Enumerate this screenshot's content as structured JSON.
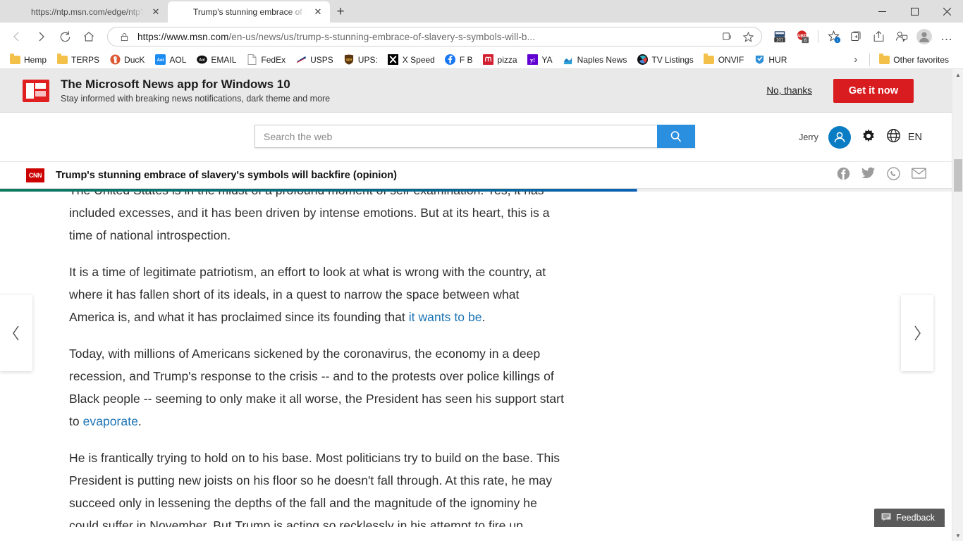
{
  "window": {
    "minimize": "–",
    "maximize": "□",
    "close": "✕"
  },
  "tabs": [
    {
      "title": "https://ntp.msn.com/edge/ntp?locale",
      "favicon": "none",
      "active": false,
      "close_label": "✕"
    },
    {
      "title": "Trump's stunning embrace of sla",
      "favicon": "msn-icon",
      "active": true,
      "close_label": "✕"
    }
  ],
  "new_tab_label": "+",
  "nav": {
    "back": "back-arrow-icon",
    "forward": "forward-arrow-icon",
    "refresh": "refresh-icon",
    "home": "home-icon"
  },
  "omnibox": {
    "lock": "lock-icon",
    "url_prefix": "https://www.",
    "url_domain": "msn.com",
    "url_rest": "/en-us/news/us/trump-s-stunning-embrace-of-slavery-s-symbols-will-b...",
    "url_full": "https://www.msn.com/en-us/news/us/trump-s-stunning-embrace-of-slavery-s-symbols-will-b...",
    "read_aloud": "read-aloud-icon",
    "favorite": "star-icon"
  },
  "toolbar": {
    "collections_badge": "101",
    "adblock_badge": "6",
    "adblock_label": "ABP",
    "favorites": "favorites-star-icon",
    "collections": "collections-icon",
    "share": "share-icon",
    "profile_mini": "profile-add-icon",
    "account": "account-avatar-icon",
    "settings_more": "…"
  },
  "bookmarks": [
    {
      "label": "Hemp",
      "icon": "folder-icon"
    },
    {
      "label": "TERPS",
      "icon": "folder-icon"
    },
    {
      "label": "DucK",
      "icon": "duckduckgo-icon"
    },
    {
      "label": "AOL",
      "icon": "aol-icon"
    },
    {
      "label": "EMAIL",
      "icon": "aol-mail-icon"
    },
    {
      "label": "FedEx",
      "icon": "page-icon"
    },
    {
      "label": "USPS",
      "icon": "usps-icon"
    },
    {
      "label": "UPS:",
      "icon": "ups-icon"
    },
    {
      "label": "X Speed",
      "icon": "x-speed-icon"
    },
    {
      "label": "F B",
      "icon": "facebook-icon"
    },
    {
      "label": "pizza",
      "icon": "pizza-icon"
    },
    {
      "label": "YA",
      "icon": "yahoo-icon"
    },
    {
      "label": "Naples News",
      "icon": "naples-news-icon"
    },
    {
      "label": "TV Listings",
      "icon": "tv-listings-icon"
    },
    {
      "label": "ONVIF",
      "icon": "folder-icon"
    },
    {
      "label": "HUR",
      "icon": "hur-icon"
    }
  ],
  "bookmarks_overflow": "›",
  "other_favorites": {
    "label": "Other favorites",
    "icon": "folder-icon"
  },
  "promo": {
    "logo": "msn-news-app-icon",
    "title": "The Microsoft News app for Windows 10",
    "subtitle": "Stay informed with breaking news notifications, dark theme and more",
    "decline_label": "No, thanks",
    "accept_label": "Get it now",
    "accept_color": "#d81c20"
  },
  "msn_header": {
    "search_placeholder": "Search the web",
    "search_value": "",
    "search_icon": "magnifier-icon",
    "search_button_color": "#2b8fe0",
    "user_name": "Jerry",
    "avatar_icon": "person-icon",
    "settings_icon": "gear-icon",
    "globe_icon": "globe-icon",
    "language": "EN"
  },
  "article_bar": {
    "source": "CNN",
    "title": "Trump's stunning embrace of slavery's symbols will backfire (opinion)",
    "share": [
      {
        "name": "facebook-share-icon"
      },
      {
        "name": "twitter-share-icon"
      },
      {
        "name": "whatsapp-share-icon"
      },
      {
        "name": "email-share-icon"
      }
    ]
  },
  "reading_progress": {
    "percent": 66,
    "gradient_start": "#0e7a5f",
    "gradient_end": "#0b62b4"
  },
  "article": {
    "paragraphs": [
      {
        "parts": [
          {
            "text": "The United States is in the midst of a profound moment of self-examination. Yes, it has included excesses, and it has been driven by intense emotions. But at its heart, this is a time of national introspection.",
            "link": false
          }
        ]
      },
      {
        "parts": [
          {
            "text": "It is a time of legitimate patriotism, an effort to look at what is wrong with the country, at where it has fallen short of its ideals, in a quest to narrow the space between what America is, and what it has proclaimed since its founding that ",
            "link": false
          },
          {
            "text": "it wants to be",
            "link": true
          },
          {
            "text": ".",
            "link": false
          }
        ]
      },
      {
        "parts": [
          {
            "text": "Today, with millions of Americans sickened by the coronavirus, the economy in a deep recession, and Trump's response to the crisis -- and to the protests over police killings of Black people -- seeming to only make it all worse, the President has seen his support start to ",
            "link": false
          },
          {
            "text": "evaporate",
            "link": true
          },
          {
            "text": ".",
            "link": false
          }
        ]
      },
      {
        "parts": [
          {
            "text": "He is frantically trying to hold on to his base. Most politicians try to build on the base. This President is putting new joists on his floor so he doesn't fall through. At this rate, he may succeed only in lessening the depths of the fall and the magnitude of the ignominy he could suffer in November. But Trump is acting so recklessly in his attempt to fire up",
            "link": false
          }
        ]
      }
    ],
    "link_color": "#1a73b5"
  },
  "carousel": {
    "prev_label": "‹",
    "next_label": "›"
  },
  "feedback": {
    "label": "Feedback",
    "icon": "feedback-icon"
  },
  "scrollbar": {
    "up_arrow": "▲",
    "down_arrow": "▼"
  }
}
